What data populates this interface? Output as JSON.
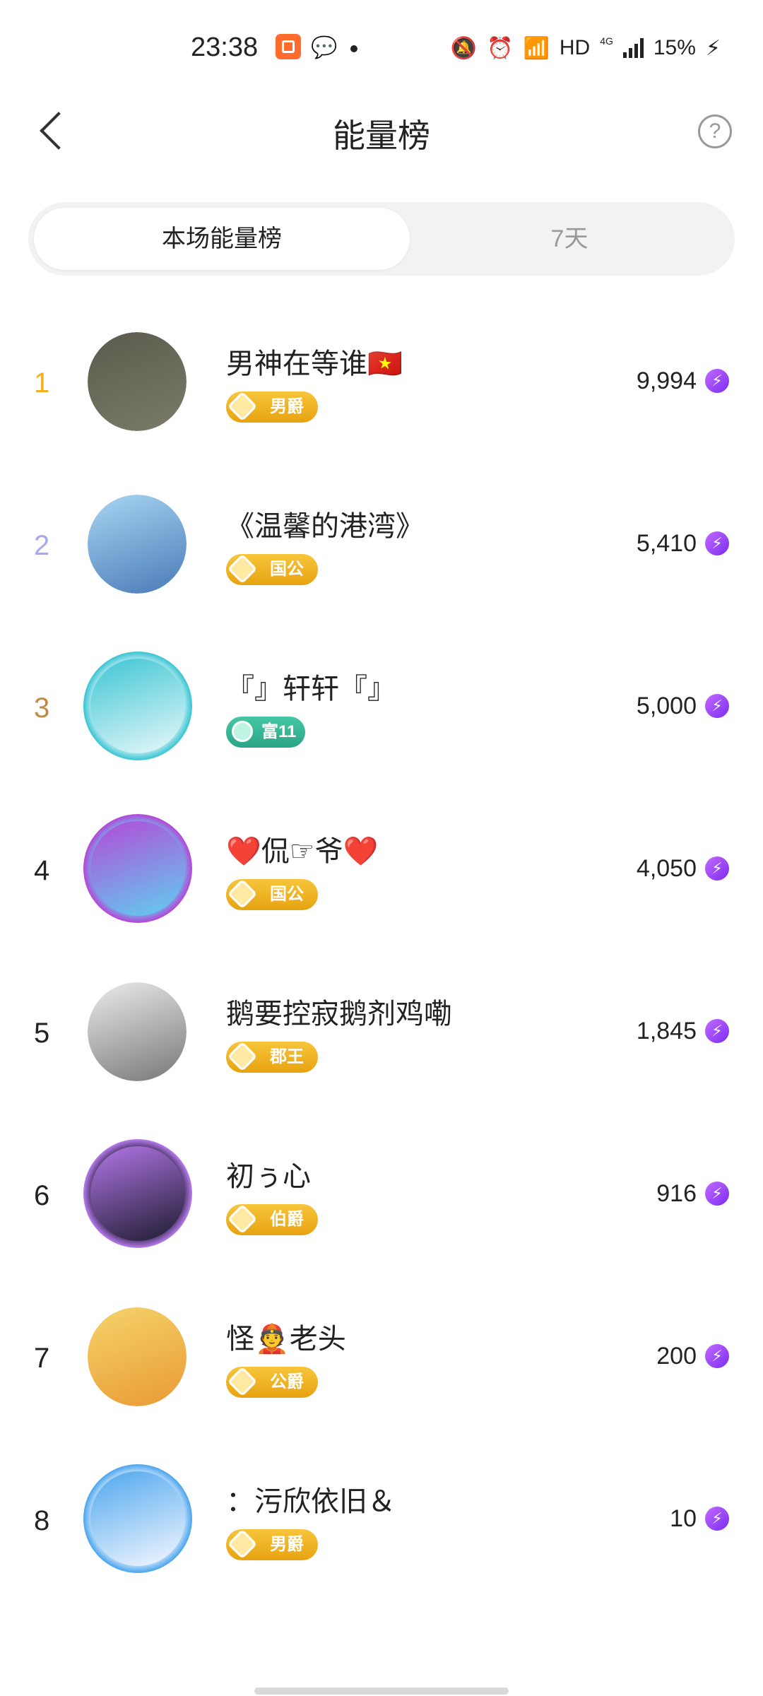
{
  "status_bar": {
    "time": "23:38",
    "network": "HD",
    "mobile": "4G",
    "battery": "15%",
    "icons": [
      "app-icon",
      "wechat-icon",
      "mute-icon",
      "alarm-icon",
      "wifi-icon",
      "signal-icon",
      "charging-icon"
    ]
  },
  "header": {
    "title": "能量榜",
    "help_glyph": "?"
  },
  "tabs": [
    {
      "label": "本场能量榜",
      "active": true
    },
    {
      "label": "7天",
      "active": false
    }
  ],
  "ranking": [
    {
      "rank": "1",
      "rank_color": "#f2b01e",
      "name": "男神在等谁🇻🇳",
      "badge": "男爵",
      "badge_type": "gold",
      "score": "9,994",
      "avatar_colors": [
        "#5a5b4c",
        "#7b7b69"
      ]
    },
    {
      "rank": "2",
      "rank_color": "#a7a9e8",
      "name": "《温馨的港湾》",
      "badge": "国公",
      "badge_type": "gold",
      "score": "5,410",
      "avatar_colors": [
        "#a8d6f2",
        "#4a7ab8"
      ]
    },
    {
      "rank": "3",
      "rank_color": "#c18b47",
      "name": "『』轩轩『』",
      "badge": "富11",
      "badge_type": "green",
      "score": "5,000",
      "avatar_colors": [
        "#3ec6d4",
        "#e8f8fa"
      ]
    },
    {
      "rank": "4",
      "rank_color": "#222222",
      "name": "❤️侃☞爷❤️",
      "badge": "国公",
      "badge_type": "gold",
      "score": "4,050",
      "avatar_colors": [
        "#b34ad7",
        "#5fd0f0"
      ]
    },
    {
      "rank": "5",
      "rank_color": "#222222",
      "name": "鹅要控寂鹅剂鸡嘞",
      "badge": "郡王",
      "badge_type": "gold",
      "score": "1,845",
      "avatar_colors": [
        "#ececec",
        "#777777"
      ]
    },
    {
      "rank": "6",
      "rank_color": "#222222",
      "name": "初ぅ心",
      "badge": "伯爵",
      "badge_type": "gold",
      "score": "916",
      "avatar_colors": [
        "#b277e8",
        "#1d1b2e"
      ]
    },
    {
      "rank": "7",
      "rank_color": "#222222",
      "name": "怪👲老头",
      "badge": "公爵",
      "badge_type": "gold",
      "score": "200",
      "avatar_colors": [
        "#f6d36b",
        "#e99a34"
      ]
    },
    {
      "rank": "8",
      "rank_color": "#222222",
      "name": "：污欣依旧＆",
      "badge": "男爵",
      "badge_type": "gold",
      "score": "10",
      "avatar_colors": [
        "#4fa7ee",
        "#f5f8ff"
      ]
    }
  ],
  "energy_glyph": "⚡"
}
